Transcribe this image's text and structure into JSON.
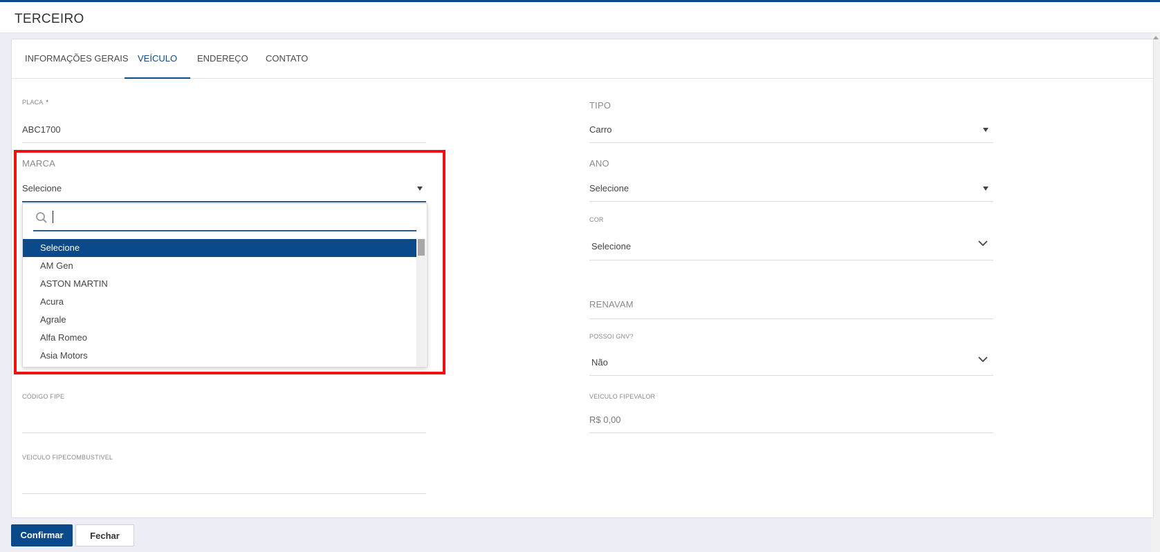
{
  "header": {
    "title": "TERCEIRO"
  },
  "tabs": [
    {
      "label": "INFORMAÇÕES GERAIS",
      "active": false
    },
    {
      "label": "VEÍCULO",
      "active": true
    },
    {
      "label": "ENDEREÇO",
      "active": false
    },
    {
      "label": "CONTATO",
      "active": false
    }
  ],
  "form": {
    "placa": {
      "label": "PLACA",
      "required_mark": "*",
      "value": "ABC1700"
    },
    "tipo": {
      "label": "TIPO",
      "value": "Carro"
    },
    "marca": {
      "label": "MARCA",
      "value": "Selecione"
    },
    "ano": {
      "label": "ANO",
      "value": "Selecione"
    },
    "cor": {
      "label": "COR",
      "value": "Selecione"
    },
    "renavam": {
      "placeholder": "RENAVAM"
    },
    "gnv": {
      "label": "POSSOI GNV?",
      "value": "Não"
    },
    "codigo_fipe": {
      "label": "CÓDIGO FIPE",
      "value": ""
    },
    "fipe_valor": {
      "label": "VEICULO FIPEVALOR",
      "value": "R$ 0,00"
    },
    "fipe_combustivel": {
      "label": "VEICULO FIPECOMBUSTIVEL",
      "value": ""
    }
  },
  "marca_dropdown": {
    "search_value": "",
    "options": [
      "Selecione",
      "AM Gen",
      "ASTON MARTIN",
      "Acura",
      "Agrale",
      "Alfa Romeo",
      "Asia Motors"
    ],
    "selected_index": 0
  },
  "footer": {
    "confirm_label": "Confirmar",
    "close_label": "Fechar"
  },
  "colors": {
    "accent": "#0a4a8a",
    "highlight": "#ee1111"
  }
}
